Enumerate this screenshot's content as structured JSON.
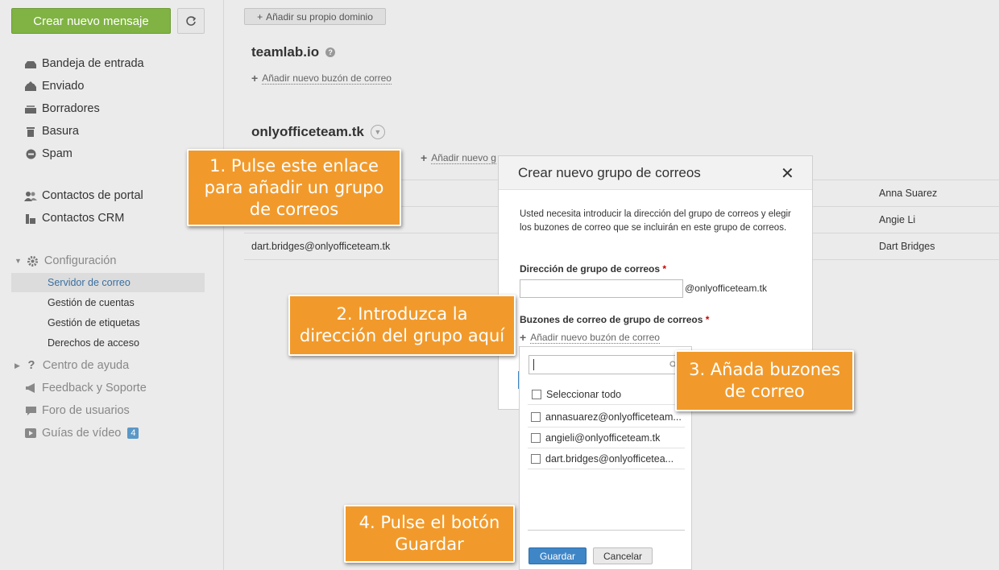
{
  "sidebar": {
    "new_message": "Crear nuevo mensaje",
    "folders": [
      {
        "label": "Bandeja de entrada",
        "icon": "inbox-icon"
      },
      {
        "label": "Enviado",
        "icon": "sent-icon"
      },
      {
        "label": "Borradores",
        "icon": "drafts-icon"
      },
      {
        "label": "Basura",
        "icon": "trash-icon"
      },
      {
        "label": "Spam",
        "icon": "spam-icon"
      }
    ],
    "contacts": [
      {
        "label": "Contactos de portal",
        "icon": "people-icon"
      },
      {
        "label": "Contactos CRM",
        "icon": "crm-icon"
      }
    ],
    "settings": {
      "label": "Configuración",
      "items": [
        "Servidor de correo",
        "Gestión de cuentas",
        "Gestión de etiquetas",
        "Derechos de acceso"
      ]
    },
    "help": [
      {
        "label": "Centro de ayuda",
        "icon": "help-icon"
      },
      {
        "label": "Feedback y Soporte",
        "icon": "megaphone-icon"
      },
      {
        "label": "Foro de usuarios",
        "icon": "forum-icon"
      },
      {
        "label": "Guías de vídeo",
        "icon": "video-icon",
        "badge": "4"
      }
    ]
  },
  "main": {
    "add_domain": "Añadir su propio dominio",
    "domain1": {
      "name": "teamlab.io",
      "add_mailbox": "Añadir nuevo buzón de correo"
    },
    "domain2": {
      "name": "onlyofficeteam.tk",
      "add_partial": "Añadir nuevo g",
      "rows": [
        {
          "email": "",
          "name": "Anna Suarez"
        },
        {
          "email": "",
          "name": "Angie Li"
        },
        {
          "email": "dart.bridges@onlyofficeteam.tk",
          "name": "Dart Bridges"
        }
      ]
    }
  },
  "dialog": {
    "title": "Crear nuevo grupo de correos",
    "description": "Usted necesita introducir la dirección del grupo de correos y elegir los buzones de correo que se incluirán en este grupo de correos.",
    "address_label": "Dirección de grupo de correos",
    "address_value": "",
    "domain_suffix": "@onlyofficeteam.tk",
    "mailboxes_label": "Buzones de correo de grupo de correos",
    "add_mailbox": "Añadir nuevo buzón de correo",
    "required_mark": "*"
  },
  "dropdown": {
    "search_value": "",
    "select_all": "Seleccionar todo",
    "items": [
      "annasuarez@onlyofficeteam...",
      "angieli@onlyofficeteam.tk",
      "dart.bridges@onlyofficetea..."
    ]
  },
  "buttons": {
    "save": "Guardar",
    "cancel": "Cancelar"
  },
  "callouts": {
    "c1": "1. Pulse este enlace para añadir un grupo de correos",
    "c2": "2. Introduzca la dirección del grupo aquí",
    "c3": "3. Añada buzones de correo",
    "c4": "4. Pulse el botón Guardar"
  },
  "colors": {
    "accent_green": "#80b343",
    "callout_orange": "#f19a2b",
    "save_blue": "#3f86c7"
  }
}
